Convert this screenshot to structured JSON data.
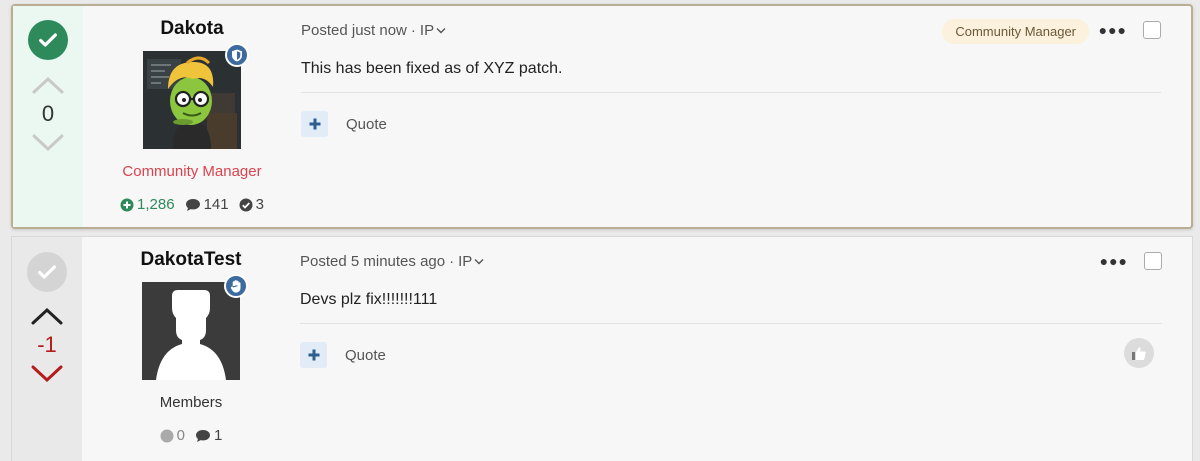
{
  "posts": [
    {
      "solved": true,
      "votes": "0",
      "author": {
        "name": "Dakota",
        "group": "Community Manager",
        "reputation": "1,286",
        "posts": "141",
        "solutions": "3"
      },
      "meta": {
        "posted": "Posted just now",
        "separator": "·",
        "ip_label": "IP"
      },
      "role_badge": "Community Manager",
      "text": "This has been fixed as of XYZ patch.",
      "actions": {
        "quote": "Quote"
      },
      "colors": {
        "solved": "#2e8a5b",
        "group": "#d9434f",
        "vote_column": "#eaf8f1"
      }
    },
    {
      "solved": false,
      "votes": "-1",
      "author": {
        "name": "DakotaTest",
        "group": "Members",
        "reputation": "0",
        "posts": "1"
      },
      "meta": {
        "posted": "Posted 5 minutes ago",
        "separator": "·",
        "ip_label": "IP"
      },
      "text": "Devs plz fix!!!!!!!111",
      "actions": {
        "quote": "Quote"
      },
      "colors": {
        "downvote": "#b51c1c",
        "vote_column": "#e9e9e9"
      }
    }
  ],
  "icons": {
    "solved": "check-circle-icon",
    "upvote": "chevron-up-icon",
    "downvote": "chevron-down-icon",
    "staff_badge": "shield-icon",
    "member_badge": "hand-icon",
    "reputation": "plus-circle-icon",
    "comments": "comment-icon",
    "solutions": "check-circle-icon",
    "more": "ellipsis-icon",
    "add": "plus-icon",
    "like": "thumbs-up-icon"
  }
}
